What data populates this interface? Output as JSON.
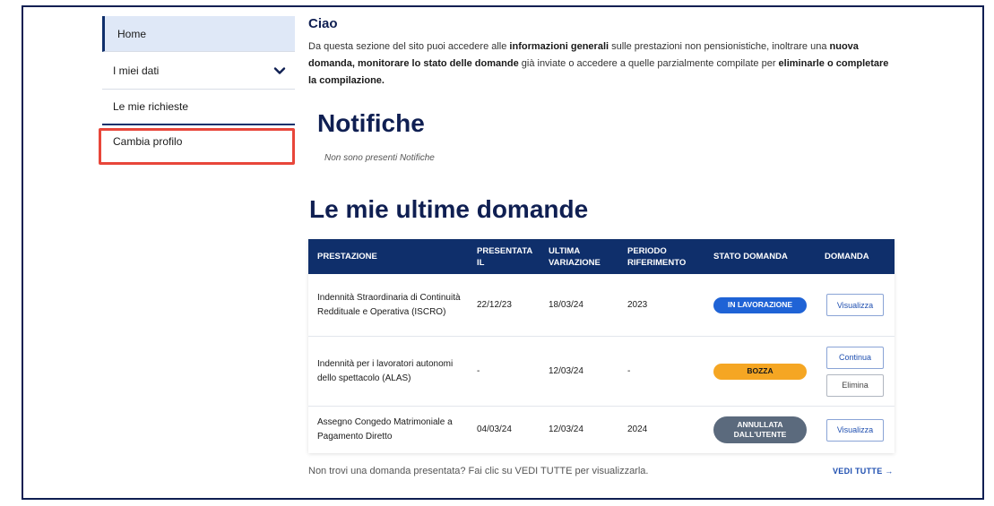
{
  "sidebar": {
    "items": [
      {
        "label": "Home"
      },
      {
        "label": "I miei dati"
      },
      {
        "label": "Le mie richieste"
      },
      {
        "label": "Cambia profilo"
      }
    ]
  },
  "intro": {
    "greeting": "Ciao",
    "p1": "Da questa sezione del sito puoi accedere alle ",
    "b1": "informazioni generali",
    "p2": " sulle prestazioni non pensionistiche, inoltrare una ",
    "b2": "nuova domanda, monitorare lo stato delle domande",
    "p3": " già inviate o accedere a quelle parzialmente compilate per ",
    "b3": "eliminarle o completare la compilazione."
  },
  "notifiche": {
    "title": "Notifiche",
    "empty": "Non sono presenti Notifiche"
  },
  "domande": {
    "title": "Le mie ultime domande",
    "headers": [
      "PRESTAZIONE",
      "PRESENTATA IL",
      "ULTIMA VARIAZIONE",
      "PERIODO RIFERIMENTO",
      "STATO DOMANDA",
      "DOMANDA"
    ],
    "rows": [
      {
        "prestazione": "Indennità Straordinaria di Continuità Reddituale e Operativa (ISCRO)",
        "presentata": "22/12/23",
        "variazione": "18/03/24",
        "periodo": "2023",
        "stato": "IN LAVORAZIONE",
        "actions": [
          "Visualizza"
        ]
      },
      {
        "prestazione": "Indennità per i lavoratori autonomi dello spettacolo (ALAS)",
        "presentata": "-",
        "variazione": "12/03/24",
        "periodo": "-",
        "stato": "BOZZA",
        "actions": [
          "Continua",
          "Elimina"
        ]
      },
      {
        "prestazione": "Assegno Congedo Matrimoniale a Pagamento Diretto",
        "presentata": "04/03/24",
        "variazione": "12/03/24",
        "periodo": "2024",
        "stato": "ANNULLATA DALL'UTENTE",
        "actions": [
          "Visualizza"
        ]
      }
    ],
    "footer_note": "Non trovi una domanda presentata? Fai clic su VEDI TUTTE per visualizzarla.",
    "vedi_tutte": "VEDI TUTTE →"
  },
  "colors": {
    "navy": "#0f2f6b",
    "accent_blue": "#1f63d6",
    "bozza": "#f5a623",
    "annullata": "#5b6a7d",
    "highlight": "#e8463a"
  }
}
